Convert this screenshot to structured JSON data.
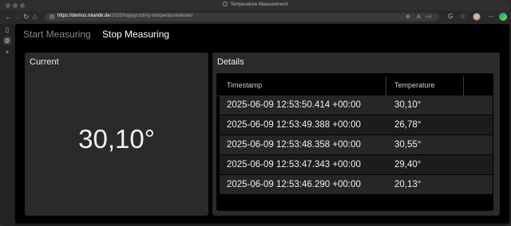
{
  "window": {
    "title": "Temperature Measurement"
  },
  "browser": {
    "url_host": "https://demos.rolandk.de",
    "url_path": "/2025/happycoding-temperatureviewer/"
  },
  "toolbar": {
    "start_label": "Start Measuring",
    "stop_label": "Stop Measuring"
  },
  "current": {
    "title": "Current",
    "value": "30,10°"
  },
  "details": {
    "title": "Details",
    "columns": [
      "Timestamp",
      "Temperature"
    ],
    "rows": [
      {
        "timestamp": "2025-06-09 12:53:50.414 +00:00",
        "temperature": "30,10°"
      },
      {
        "timestamp": "2025-06-09 12:53:49.388 +00:00",
        "temperature": "26,78°"
      },
      {
        "timestamp": "2025-06-09 12:53:48.358 +00:00",
        "temperature": "30,55°"
      },
      {
        "timestamp": "2025-06-09 12:53:47.343 +00:00",
        "temperature": "29,40°"
      },
      {
        "timestamp": "2025-06-09 12:53:46.290 +00:00",
        "temperature": "20,13°"
      }
    ]
  },
  "icons": {
    "back": "←",
    "forward": "→",
    "reload": "↻",
    "home": "⌂",
    "more": "⋯",
    "star": "☆",
    "sidebar_toggle": "▯",
    "add": "+"
  },
  "colors": {
    "page_bg": "#000000",
    "card_bg": "#2a2a2a",
    "start_text": "#8a8a8a",
    "stop_text": "#ffffff"
  }
}
